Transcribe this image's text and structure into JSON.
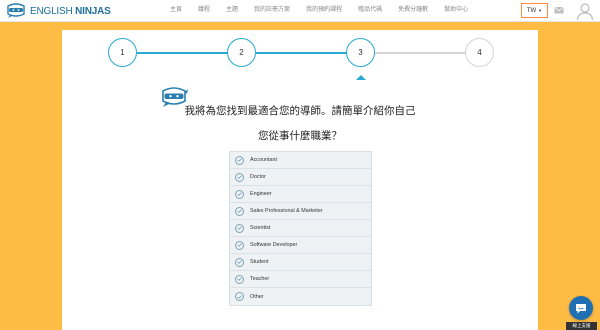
{
  "header": {
    "logo": {
      "text_light": "ENGLISH",
      "text_bold": "NINJAS"
    },
    "nav": [
      "主頁",
      "議程",
      "主題",
      "我的註冊方案",
      "我的預約課程",
      "贈品代碼",
      "免費分鐘數",
      "幫助中心"
    ],
    "language": "TW"
  },
  "stepper": {
    "steps": [
      "1",
      "2",
      "3",
      "4"
    ],
    "current": 3,
    "active_color": "#2aa9d4",
    "inactive_color": "#d5d5d5"
  },
  "onboarding": {
    "intro": "我將為您找到最適合您的導師。請簡單介紹你自己",
    "question": "您從事什麼職業？",
    "options": [
      "Accountant",
      "Doctor",
      "Engineer",
      "Sales Professional & Marketer",
      "Scientist",
      "Software Developer",
      "Student",
      "Teacher",
      "Other"
    ]
  },
  "chat": {
    "label": "線上支援"
  },
  "colors": {
    "background": "#ffbc45",
    "accent": "#2aa9d4",
    "brand": "#1f6f9c"
  }
}
